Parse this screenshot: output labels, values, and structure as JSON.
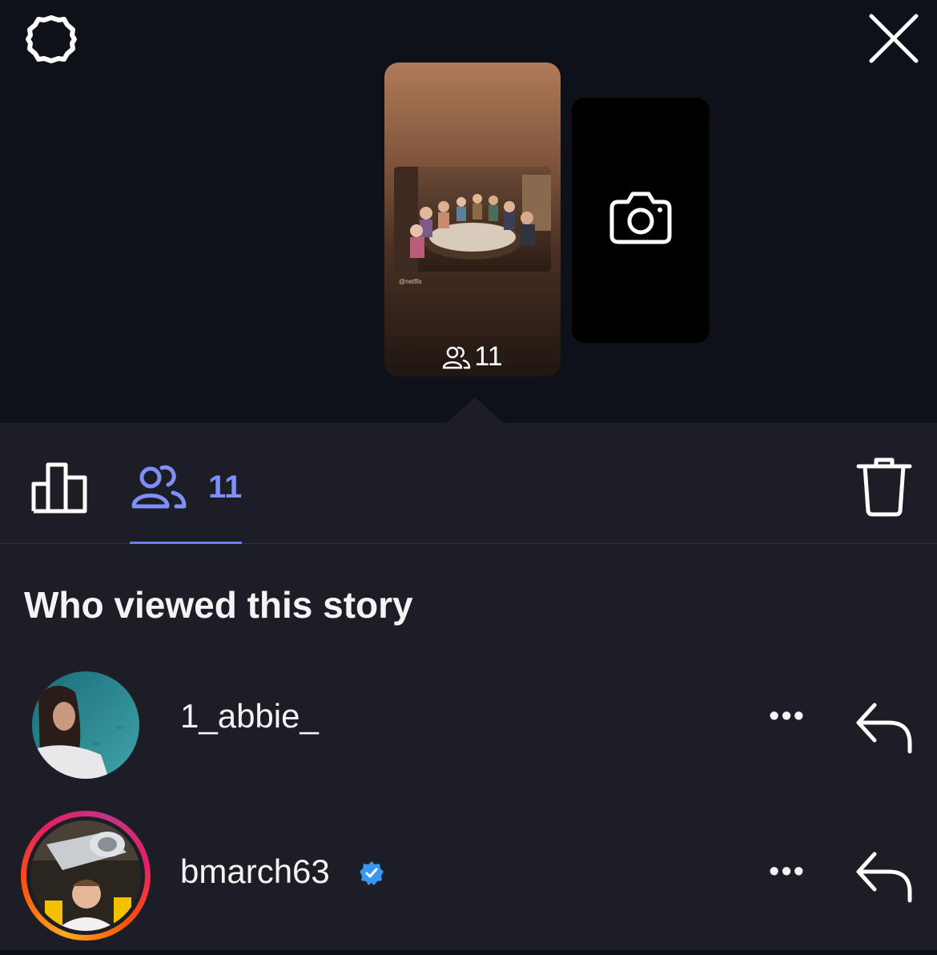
{
  "header": {
    "settings_icon": "settings-gear-icon",
    "close_icon": "close-x-icon"
  },
  "story": {
    "credit": "@netflix",
    "view_count": "11",
    "views_icon": "people-icon"
  },
  "camera_card": {
    "icon": "camera-icon"
  },
  "tabs": {
    "insights_icon": "bar-chart-icon",
    "viewers_icon": "people-icon",
    "viewers_count": "11",
    "delete_icon": "trash-icon",
    "accent_color": "#7e8ff7"
  },
  "viewers_section": {
    "heading": "Who viewed this story",
    "viewers": [
      {
        "username": "1_abbie_",
        "verified": false,
        "more_label": "•••",
        "reply_icon": "reply-arrow-icon"
      },
      {
        "username": "bmarch63",
        "verified": true,
        "more_label": "•••",
        "reply_icon": "reply-arrow-icon",
        "story_ring": true
      }
    ]
  }
}
